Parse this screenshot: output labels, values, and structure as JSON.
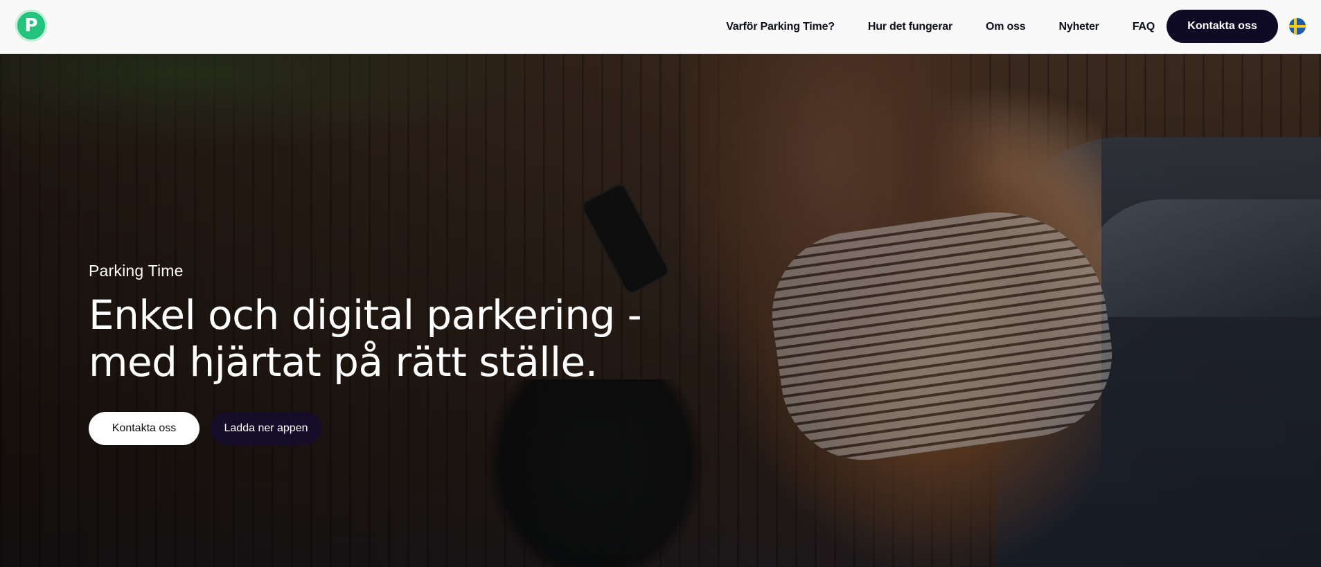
{
  "header": {
    "logo_letter": "P",
    "nav": [
      {
        "label": "Varför Parking Time?"
      },
      {
        "label": "Hur det fungerar"
      },
      {
        "label": "Om oss"
      },
      {
        "label": "Nyheter"
      },
      {
        "label": "FAQ"
      }
    ],
    "contact_label": "Kontakta oss",
    "language_flag": "sweden-flag-icon"
  },
  "hero": {
    "eyebrow": "Parking Time",
    "headline": "Enkel och digital parkering - med hjärtat på rätt ställe.",
    "buttons": {
      "primary_label": "Kontakta oss",
      "secondary_label": "Ladda ner appen"
    }
  },
  "colors": {
    "brand_green": "#22c47e",
    "dark_button": "#0f0a26",
    "header_bg": "#f9f9f9"
  }
}
